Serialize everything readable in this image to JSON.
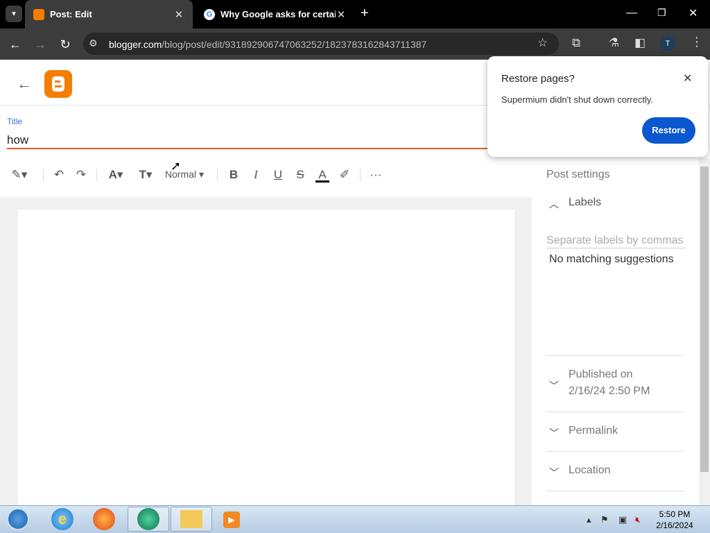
{
  "browser": {
    "tabs": [
      {
        "title": "Post: Edit",
        "active": true,
        "favicon_color": "#f57d00"
      },
      {
        "title": "Why Google asks for certain in",
        "active": false,
        "favicon_color": "#ffffff"
      }
    ],
    "new_tab": "+",
    "url_host": "blogger.com",
    "url_path": "/blog/post/edit/931892906747063252/1823783162843711387",
    "profile_initial": "T"
  },
  "editor": {
    "title_label": "Title",
    "title_value": "how",
    "style_select": "Normal",
    "accent_color": "#e45b2b"
  },
  "settings": {
    "heading": "Post settings",
    "labels_heading": "Labels",
    "labels_placeholder": "Separate labels by commas",
    "no_match": "No matching suggestions",
    "published_line1": "Published on",
    "published_line2": "2/16/24 2:50 PM",
    "permalink": "Permalink",
    "location": "Location"
  },
  "popup": {
    "title": "Restore pages?",
    "message": "Supermium didn't shut down correctly.",
    "button": "Restore",
    "button_color": "#0b57d0"
  },
  "taskbar": {
    "time": "5:50 PM",
    "date": "2/16/2024"
  }
}
